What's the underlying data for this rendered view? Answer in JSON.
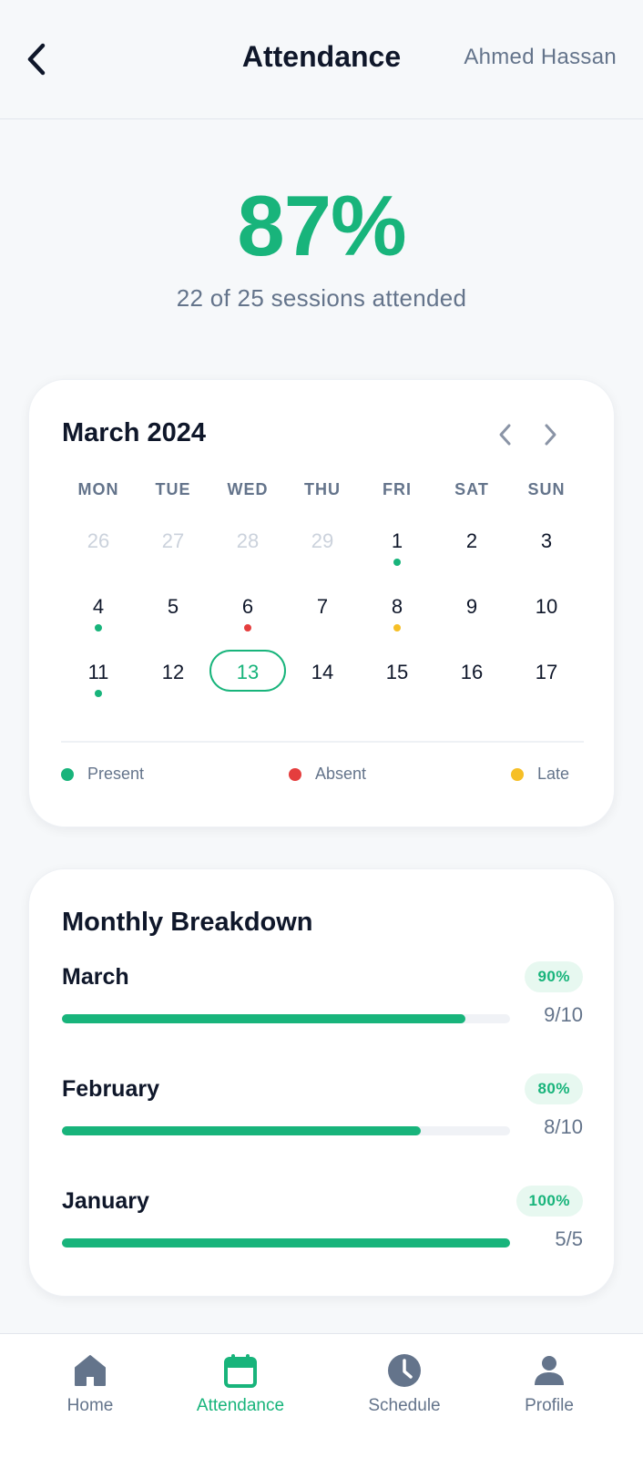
{
  "header": {
    "title": "Attendance",
    "user": "Ahmed Hassan",
    "back_icon": "chevron-left-icon"
  },
  "summary": {
    "percent": "87%",
    "sessions_text": "22 of 25 sessions attended"
  },
  "calendar": {
    "month_label": "March 2024",
    "weekdays": [
      "MON",
      "TUE",
      "WED",
      "THU",
      "FRI",
      "SAT",
      "SUN"
    ],
    "weeks": [
      [
        {
          "d": "26",
          "muted": true
        },
        {
          "d": "27",
          "muted": true
        },
        {
          "d": "28",
          "muted": true
        },
        {
          "d": "29",
          "muted": true
        },
        {
          "d": "1",
          "status": "present"
        },
        {
          "d": "2"
        },
        {
          "d": "3"
        }
      ],
      [
        {
          "d": "4",
          "status": "present"
        },
        {
          "d": "5"
        },
        {
          "d": "6",
          "status": "absent"
        },
        {
          "d": "7"
        },
        {
          "d": "8",
          "status": "late"
        },
        {
          "d": "9"
        },
        {
          "d": "10"
        }
      ],
      [
        {
          "d": "11",
          "status": "present"
        },
        {
          "d": "12"
        },
        {
          "d": "13",
          "today": true
        },
        {
          "d": "14"
        },
        {
          "d": "15"
        },
        {
          "d": "16"
        },
        {
          "d": "17"
        }
      ]
    ],
    "legend": {
      "present": "Present",
      "absent": "Absent",
      "late": "Late"
    }
  },
  "breakdown": {
    "title": "Monthly Breakdown",
    "months": [
      {
        "name": "March",
        "percent": "90%",
        "progress": 0.9,
        "count": "9/10"
      },
      {
        "name": "February",
        "percent": "80%",
        "progress": 0.8,
        "count": "8/10"
      },
      {
        "name": "January",
        "percent": "100%",
        "progress": 1.0,
        "count": "5/5"
      }
    ]
  },
  "nav": [
    {
      "label": "Home",
      "icon": "home-icon",
      "active": false
    },
    {
      "label": "Attendance",
      "icon": "calendar-icon",
      "active": true
    },
    {
      "label": "Schedule",
      "icon": "clock-icon",
      "active": false
    },
    {
      "label": "Profile",
      "icon": "user-icon",
      "active": false
    }
  ],
  "colors": {
    "accent": "#18b47b",
    "present": "#18b47b",
    "absent": "#e53e3e",
    "late": "#f6bf26",
    "muted_text": "#64748b"
  }
}
